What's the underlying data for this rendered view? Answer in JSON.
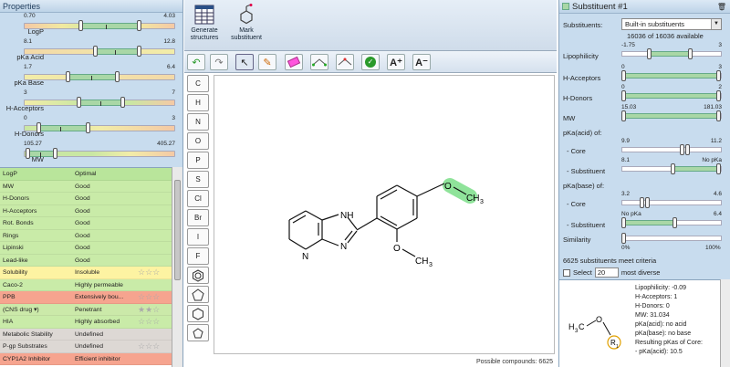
{
  "properties_panel": {
    "title": "Properties",
    "sliders": [
      {
        "name": "LogP",
        "min": "0.70",
        "max": "4.03"
      },
      {
        "name": "pKa Acid",
        "min": "8.1",
        "max": "12.8"
      },
      {
        "name": "pKa Base",
        "min": "1.7",
        "max": "6.4"
      },
      {
        "name": "H-Acceptors",
        "min": "3",
        "max": "7"
      },
      {
        "name": "H-Donors",
        "min": "0",
        "max": "3"
      },
      {
        "name": "MW",
        "min": "105.27",
        "max": "405.27"
      }
    ],
    "table": [
      {
        "name": "LogP",
        "value": "Optimal",
        "stars": "",
        "status": "opt"
      },
      {
        "name": "MW",
        "value": "Good",
        "stars": "",
        "status": "good"
      },
      {
        "name": "H-Donors",
        "value": "Good",
        "stars": "",
        "status": "good"
      },
      {
        "name": "H-Acceptors",
        "value": "Good",
        "stars": "",
        "status": "good"
      },
      {
        "name": "Rot. Bonds",
        "value": "Good",
        "stars": "",
        "status": "good"
      },
      {
        "name": "Rings",
        "value": "Good",
        "stars": "",
        "status": "good"
      },
      {
        "name": "Lipinski",
        "value": "Good",
        "stars": "",
        "status": "good"
      },
      {
        "name": "Lead-like",
        "value": "Good",
        "stars": "",
        "status": "good"
      },
      {
        "name": "Solubility",
        "value": "Insoluble",
        "stars": "☆☆☆",
        "status": "warn"
      },
      {
        "name": "Caco-2",
        "value": "Highly permeable",
        "stars": "",
        "status": "good"
      },
      {
        "name": "PPB",
        "value": "Extensively bou...",
        "stars": "☆☆☆",
        "status": "bad"
      },
      {
        "name": "(CNS drug ▾)",
        "value": "Penetrant",
        "stars": "★★☆",
        "status": "cns"
      },
      {
        "name": "HIA",
        "value": "Highly absorbed",
        "stars": "☆☆☆",
        "status": "good"
      },
      {
        "name": "Metabolic Stability",
        "value": "Undefined",
        "stars": "",
        "status": "neutral"
      },
      {
        "name": "P-gp Substrates",
        "value": "Undefined",
        "stars": "☆☆☆",
        "status": "neutral"
      },
      {
        "name": "CYP1A2 Inhibitor",
        "value": "Efficient inhibitor",
        "stars": "",
        "status": "bad"
      }
    ]
  },
  "toolbar": {
    "generate_label_1": "Generate",
    "generate_label_2": "structures",
    "mark_label_1": "Mark",
    "mark_label_2": "substituent"
  },
  "atoms": [
    "C",
    "H",
    "N",
    "O",
    "P",
    "S",
    "Cl",
    "Br",
    "I",
    "F"
  ],
  "canvas": {
    "atom_labels": {
      "nh": "NH",
      "n": "N",
      "n2": "N",
      "o1": "O",
      "ch3_1": "CH",
      "ch3_1_sub": "3",
      "o2": "O",
      "ch3_2": "CH",
      "ch3_2_sub": "3"
    },
    "possible_compounds": "Possible compounds: 6625"
  },
  "substituent_panel": {
    "title": "Substituent #1",
    "substituents_label": "Substituents:",
    "substituents_value": "Built-in substituents",
    "available": "16036 of 16036 available",
    "rows": [
      {
        "label": "Lipophilicity",
        "min": "-1.75",
        "max": "3"
      },
      {
        "label": "H-Acceptors",
        "min": "0",
        "max": "3"
      },
      {
        "label": "H-Donors",
        "min": "0",
        "max": "2"
      },
      {
        "label": "MW",
        "min": "15.03",
        "max": "181.03"
      }
    ],
    "pka_acid_label": "pKa(acid) of:",
    "pka_base_label": "pKa(base) of:",
    "core_label": "- Core",
    "substituent_label": "- Substituent",
    "pka_acid_core": {
      "min": "9.9",
      "max": "11.2"
    },
    "pka_acid_sub": {
      "min": "8.1",
      "max": "No pKa"
    },
    "pka_base_core": {
      "min": "3.2",
      "max": "4.6"
    },
    "pka_base_sub": {
      "min": "No pKa",
      "max": "6.4"
    },
    "similarity_label": "Similarity",
    "similarity_min": "0%",
    "similarity_max": "100%",
    "meet_criteria": "6625 substituents meet criteria",
    "select_label": "Select",
    "select_value": "20",
    "most_diverse": "most diverse",
    "detail": {
      "lines": [
        "Lipophilicity: -0.09",
        "H-Acceptors: 1",
        "H-Donors: 0",
        "MW: 31.034",
        "pKa(acid): no acid",
        "pKa(base): no base",
        "Resulting pKas of Core:",
        "- pKa(acid): 10.5"
      ],
      "struct_h3c": "H",
      "struct_h3c_sub": "3",
      "struct_c": "C",
      "struct_o": "O",
      "struct_r": "R",
      "struct_r_sub": "1"
    }
  },
  "colors": {
    "accent_green": "#a9d7a6",
    "highlight": "#8fe39a",
    "panel_bg": "#c8dcee"
  }
}
